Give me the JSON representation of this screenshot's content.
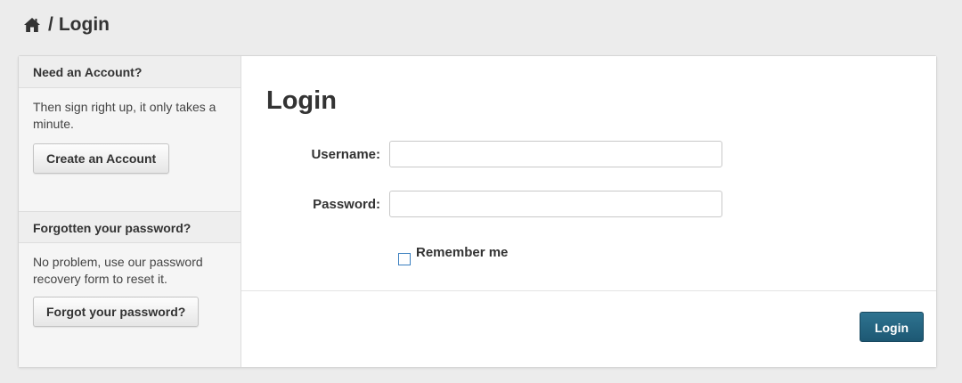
{
  "breadcrumb": {
    "icon": "home-icon",
    "separator": "/",
    "current": "Login"
  },
  "sidebar": {
    "account_section": {
      "header": "Need an Account?",
      "text": "Then sign right up, it only takes a minute.",
      "button_label": "Create an Account"
    },
    "password_section": {
      "header": "Forgotten your password?",
      "text": "No problem, use our password recovery form to reset it.",
      "button_label": "Forgot your password?"
    }
  },
  "form": {
    "title": "Login",
    "username_label": "Username:",
    "username_value": "",
    "password_label": "Password:",
    "password_value": "",
    "remember_label": "Remember me",
    "remember_checked": false,
    "submit_label": "Login"
  },
  "colors": {
    "background": "#ececec",
    "accent": "#1d5873",
    "checkbox_border": "#3a7fbf"
  }
}
